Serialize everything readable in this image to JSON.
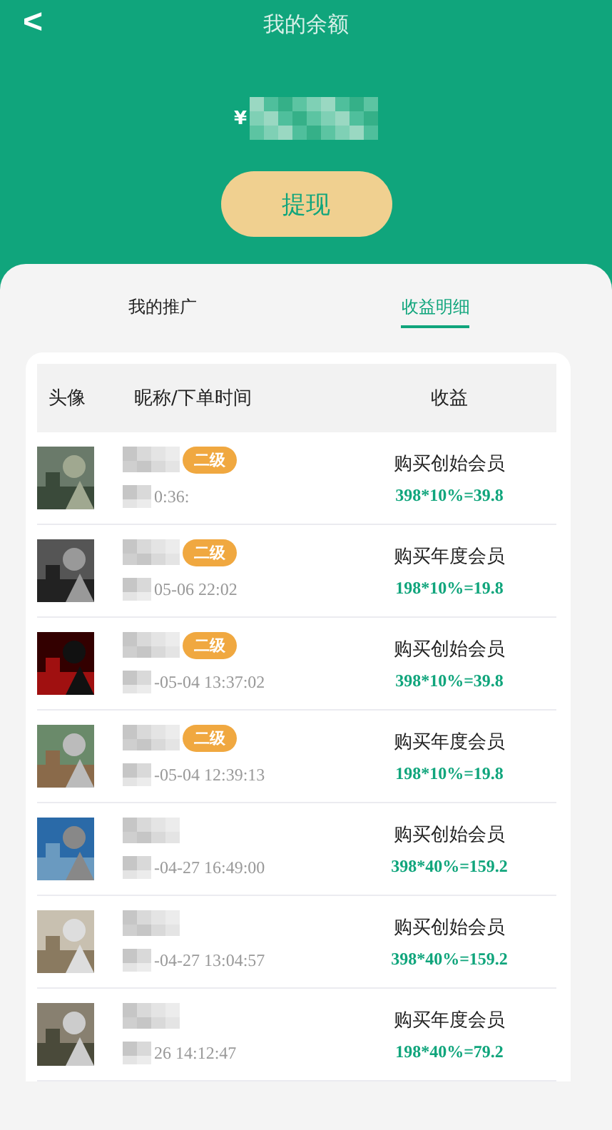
{
  "header": {
    "title": "我的余额",
    "back": "<"
  },
  "balance": {
    "currency": "¥"
  },
  "withdraw_button": "提现",
  "tabs": [
    {
      "label": "我的推广",
      "selected": false
    },
    {
      "label": "收益明细",
      "selected": true
    }
  ],
  "table": {
    "columns": [
      "头像",
      "昵称/下单时间",
      "收益"
    ],
    "rows": [
      {
        "badge": "二级",
        "time": "0:36:",
        "title": "购买创始会员",
        "amount": "398*10%=39.8"
      },
      {
        "badge": "二级",
        "time": "05-06 22:02",
        "title": "购买年度会员",
        "amount": "198*10%=19.8"
      },
      {
        "badge": "二级",
        "time": "-05-04 13:37:02",
        "title": "购买创始会员",
        "amount": "398*10%=39.8"
      },
      {
        "badge": "二级",
        "time": "-05-04 12:39:13",
        "title": "购买年度会员",
        "amount": "198*10%=19.8"
      },
      {
        "time": "-04-27 16:49:00",
        "title": "购买创始会员",
        "amount": "398*40%=159.2"
      },
      {
        "time": "-04-27 13:04:57",
        "title": "购买创始会员",
        "amount": "398*40%=159.2"
      },
      {
        "time": "26 14:12:47",
        "title": "购买年度会员",
        "amount": "198*40%=79.2"
      }
    ]
  }
}
